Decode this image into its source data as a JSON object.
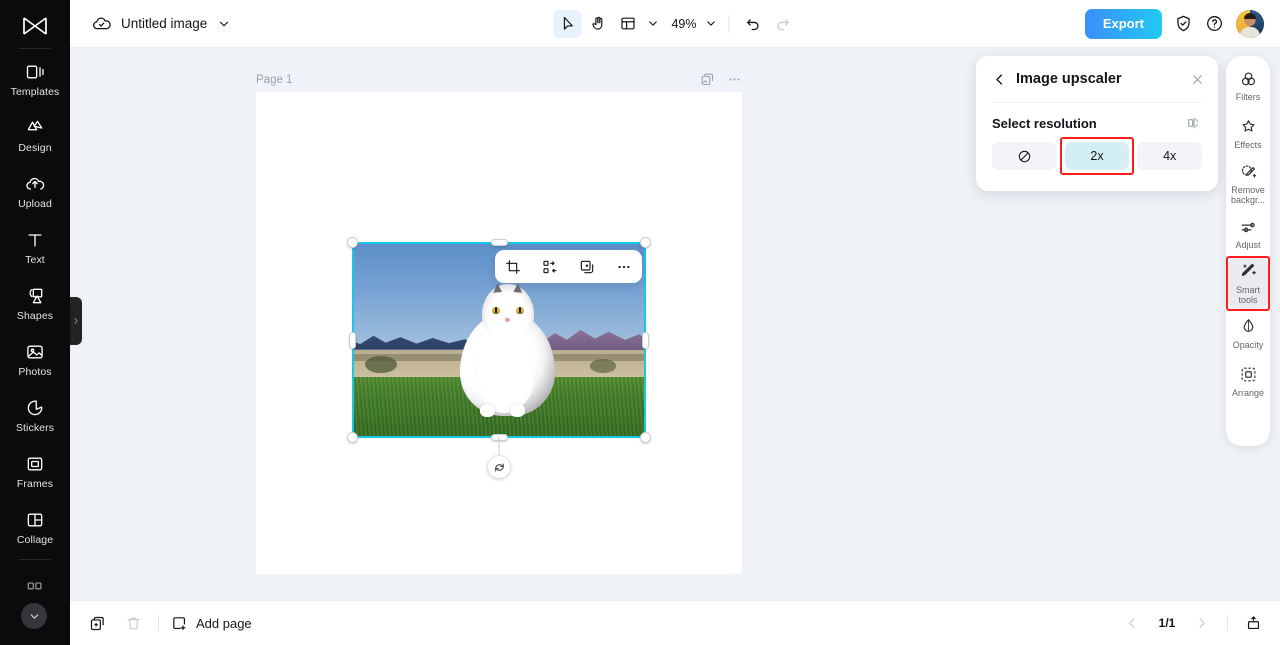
{
  "app": {
    "logo_icon": "capcut-logo-icon"
  },
  "sidebar": {
    "items": [
      {
        "label": "Templates",
        "icon": "templates-icon"
      },
      {
        "label": "Design",
        "icon": "design-icon"
      },
      {
        "label": "Upload",
        "icon": "upload-cloud-icon"
      },
      {
        "label": "Text",
        "icon": "text-icon"
      },
      {
        "label": "Shapes",
        "icon": "shapes-icon"
      },
      {
        "label": "Photos",
        "icon": "photos-icon"
      },
      {
        "label": "Stickers",
        "icon": "stickers-icon"
      },
      {
        "label": "Frames",
        "icon": "frames-icon"
      },
      {
        "label": "Collage",
        "icon": "collage-icon"
      }
    ],
    "expand_icon": "chevron-down-icon",
    "collapse_tab_icon": "chevron-right-icon"
  },
  "topbar": {
    "cloud_icon": "cloud-saved-icon",
    "doc_title": "Untitled image",
    "doc_menu_icon": "chevron-down-icon",
    "tools": {
      "select_icon": "cursor-select-icon",
      "hand_icon": "hand-pan-icon",
      "layout_icon": "layout-grid-icon",
      "layout_chevron_icon": "chevron-down-icon",
      "zoom_level": "49%",
      "zoom_chevron_icon": "chevron-down-icon",
      "undo_icon": "undo-icon",
      "redo_icon": "redo-icon"
    },
    "export_label": "Export",
    "export_gradient_from": "#3a8ffa",
    "export_gradient_to": "#22c9f0",
    "shield_icon": "shield-check-icon",
    "help_icon": "help-circle-icon",
    "avatar_icon": "user-avatar"
  },
  "canvas": {
    "page_label": "Page 1",
    "duplicate_page_icon": "duplicate-page-icon",
    "more_icon": "more-horizontal-icon",
    "selected_border_color": "#19c8e6",
    "image_toolbar": [
      {
        "icon": "crop-icon",
        "name": "crop"
      },
      {
        "icon": "replace-icon",
        "name": "replace"
      },
      {
        "icon": "duplicate-icon",
        "name": "duplicate"
      },
      {
        "icon": "more-horizontal-icon",
        "name": "more"
      }
    ],
    "rotate_icon": "rotate-icon",
    "image_description": "Fluffy white and grey long-haired cat sitting on green grass with blue sky and distant mountains"
  },
  "panel": {
    "back_icon": "chevron-left-icon",
    "title": "Image upscaler",
    "close_icon": "close-icon",
    "section_label": "Select resolution",
    "compare_icon": "before-after-compare-icon",
    "options": [
      {
        "label": "",
        "icon": "no-upscale-icon",
        "selected": false
      },
      {
        "label": "2x",
        "icon": "",
        "selected": true
      },
      {
        "label": "4x",
        "icon": "",
        "selected": false
      }
    ],
    "selected_option": "2x",
    "selected_color": "#d4eff3",
    "highlight_color": "#ff1c1c"
  },
  "rail": {
    "items": [
      {
        "label": "Filters",
        "icon": "filters-icon",
        "selected": false
      },
      {
        "label": "Effects",
        "icon": "effects-icon",
        "selected": false
      },
      {
        "label": "Remove backgr...",
        "icon": "remove-background-icon",
        "selected": false
      },
      {
        "label": "Adjust",
        "icon": "adjust-sliders-icon",
        "selected": false
      },
      {
        "label": "Smart tools",
        "icon": "smart-tools-icon",
        "selected": true
      },
      {
        "label": "Opacity",
        "icon": "opacity-drop-icon",
        "selected": false
      },
      {
        "label": "Arrange",
        "icon": "arrange-icon",
        "selected": false
      }
    ]
  },
  "bottombar": {
    "duplicate_icon": "duplicate-icon",
    "delete_icon": "trash-icon",
    "add_page_icon": "add-page-icon",
    "add_page_label": "Add page",
    "prev_icon": "chevron-left-icon",
    "page_indicator": "1/1",
    "next_icon": "chevron-right-icon",
    "present_icon": "present-icon"
  }
}
